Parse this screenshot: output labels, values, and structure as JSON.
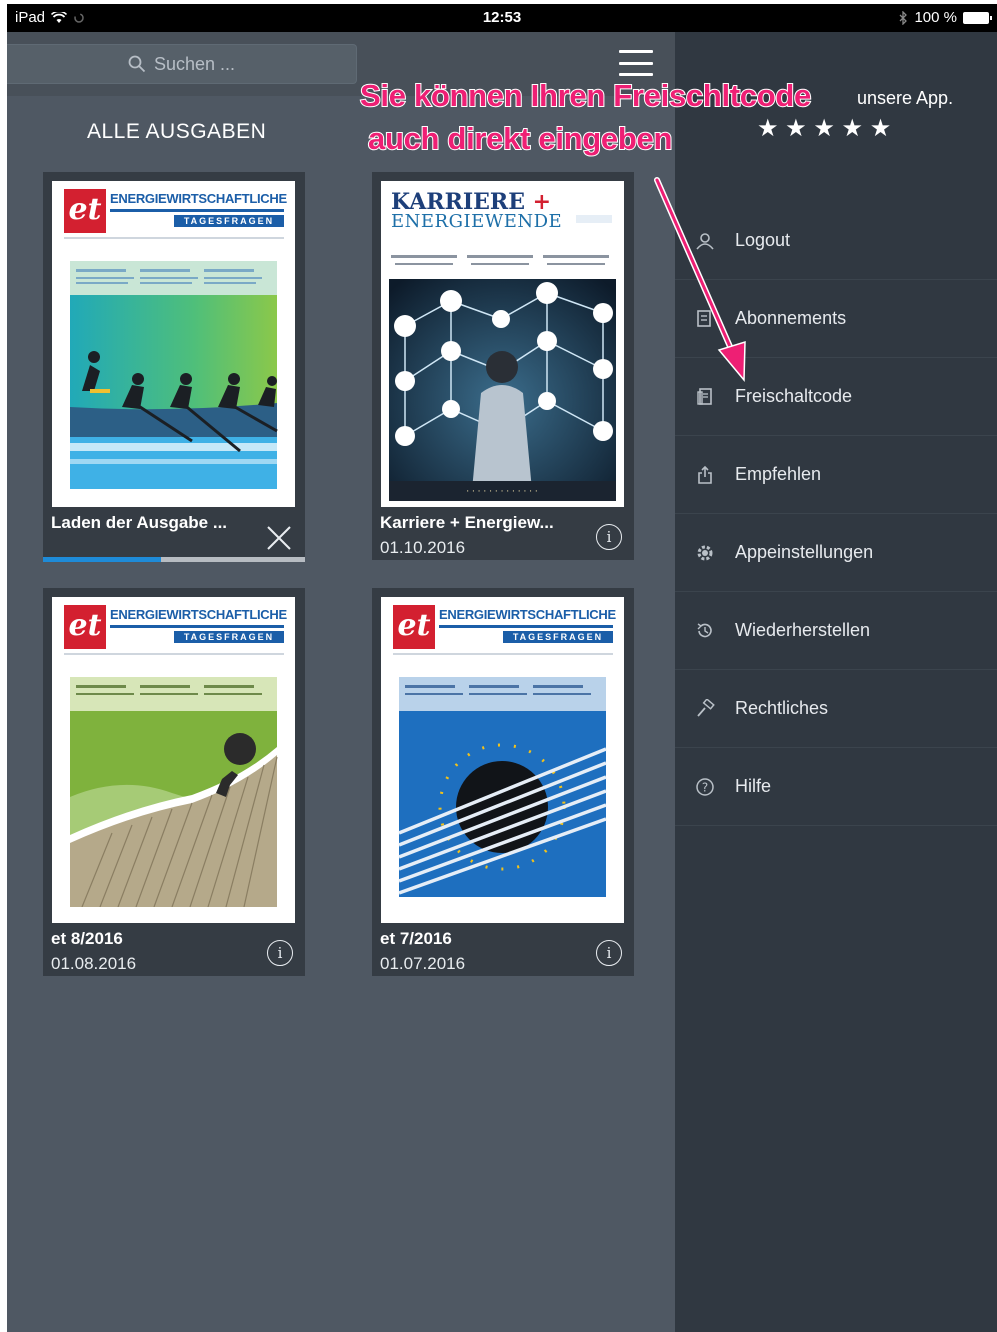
{
  "status_bar": {
    "device": "iPad",
    "time": "12:53",
    "battery": "100 %"
  },
  "search": {
    "placeholder": "Suchen ..."
  },
  "library": {
    "title": "ALLE AUSGABEN",
    "issues": [
      {
        "title": "Laden der Ausgabe ...",
        "date": "",
        "state": "downloading",
        "progress": 0.45,
        "cover": {
          "masthead_line1": "ENERGIEWIRTSCHAFTLICHE",
          "masthead_line2": "TAGESFRAGEN",
          "logo": "et"
        }
      },
      {
        "title": "Karriere + Energiew...",
        "date": "01.10.2016",
        "state": "available",
        "cover": {
          "masthead_line1": "KARRIERE",
          "masthead_plus": "+",
          "masthead_line2": "ENERGIEWENDE"
        }
      },
      {
        "title": "et 8/2016",
        "date": "01.08.2016",
        "state": "available",
        "cover": {
          "masthead_line1": "ENERGIEWIRTSCHAFTLICHE",
          "masthead_line2": "TAGESFRAGEN",
          "logo": "et"
        }
      },
      {
        "title": "et 7/2016",
        "date": "01.07.2016",
        "state": "available",
        "cover": {
          "masthead_line1": "ENERGIEWIRTSCHAFTLICHE",
          "masthead_line2": "TAGESFRAGEN",
          "logo": "et"
        }
      }
    ]
  },
  "drawer": {
    "tagline": "unsere App.",
    "stars": "★ ★ ★ ★ ★",
    "items": [
      {
        "label": "Logout",
        "icon": "user-icon"
      },
      {
        "label": "Abonnements",
        "icon": "subscriptions-icon"
      },
      {
        "label": "Freischaltcode",
        "icon": "code-icon"
      },
      {
        "label": "Empfehlen",
        "icon": "share-icon"
      },
      {
        "label": "Appeinstellungen",
        "icon": "gear-icon"
      },
      {
        "label": "Wiederherstellen",
        "icon": "restore-icon"
      },
      {
        "label": "Rechtliches",
        "icon": "hammer-icon"
      },
      {
        "label": "Hilfe",
        "icon": "help-icon"
      }
    ]
  },
  "annotation": {
    "line1": "Sie können Ihren Freischltcode",
    "line2": "auch direkt eingeben",
    "color": "#ee1f74"
  },
  "colors": {
    "library_bg": "#4f5863",
    "drawer_bg": "#303841",
    "card_bg": "#353c44",
    "progress": "#1e8bd8"
  }
}
